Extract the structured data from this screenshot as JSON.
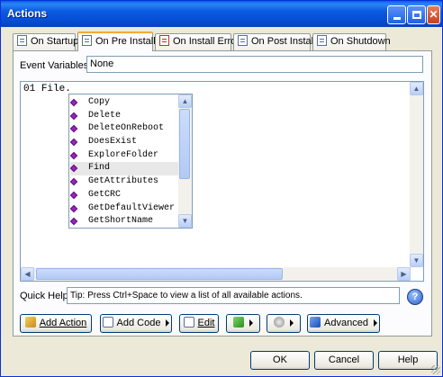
{
  "window": {
    "title": "Actions"
  },
  "tabs": [
    {
      "label": "On Startup",
      "icon": "doc-list-icon"
    },
    {
      "label": "On Pre Install",
      "icon": "doc-list-icon",
      "active": true
    },
    {
      "label": "On Install Error",
      "icon": "doc-error-icon"
    },
    {
      "label": "On Post Install",
      "icon": "doc-list-icon"
    },
    {
      "label": "On Shutdown",
      "icon": "doc-list-icon"
    }
  ],
  "event_variables": {
    "label": "Event Variables:",
    "value": "None"
  },
  "editor": {
    "line_number": "01",
    "code": "File."
  },
  "autocomplete": {
    "items": [
      "Copy",
      "Delete",
      "DeleteOnReboot",
      "DoesExist",
      "ExploreFolder",
      "Find",
      "GetAttributes",
      "GetCRC",
      "GetDefaultViewer",
      "GetShortName"
    ],
    "selected": "Find"
  },
  "quick_help": {
    "label": "Quick Help:",
    "value": "Tip: Press Ctrl+Space to view a list of all available actions."
  },
  "toolbar": {
    "add_action": "Add Action",
    "add_code": "Add Code",
    "edit": "Edit",
    "advanced": "Advanced"
  },
  "dialog_buttons": {
    "ok": "OK",
    "cancel": "Cancel",
    "help": "Help"
  },
  "colors": {
    "titlebar": "#0a5ce6",
    "accent_tab": "#f7a83a",
    "item_icon": "#9b22c2"
  }
}
